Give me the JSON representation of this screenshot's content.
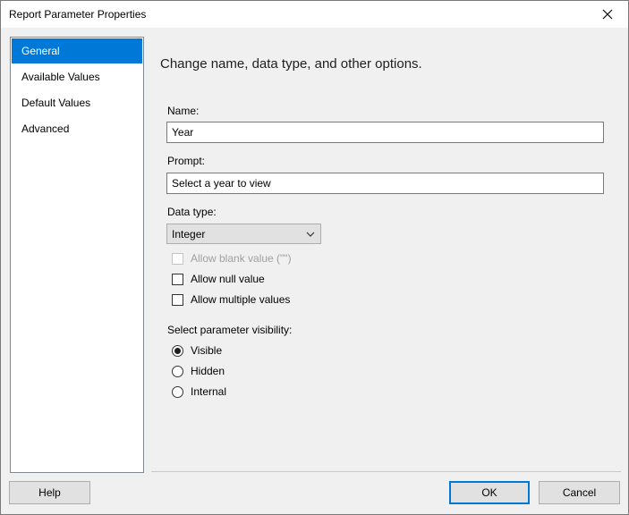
{
  "window": {
    "title": "Report Parameter Properties"
  },
  "nav": {
    "items": [
      {
        "label": "General",
        "selected": true
      },
      {
        "label": "Available Values",
        "selected": false
      },
      {
        "label": "Default Values",
        "selected": false
      },
      {
        "label": "Advanced",
        "selected": false
      }
    ]
  },
  "general": {
    "heading": "Change name, data type, and other options.",
    "name_label": "Name:",
    "name_value": "Year",
    "prompt_label": "Prompt:",
    "prompt_value": "Select a year to view",
    "datatype_label": "Data type:",
    "datatype_value": "Integer",
    "checkboxes": {
      "allow_blank": {
        "label": "Allow blank value (\"\")",
        "checked": false,
        "disabled": true
      },
      "allow_null": {
        "label": "Allow null value",
        "checked": false
      },
      "allow_multiple": {
        "label": "Allow multiple values",
        "checked": false
      }
    },
    "visibility_label": "Select parameter visibility:",
    "visibility": {
      "visible": {
        "label": "Visible",
        "checked": true
      },
      "hidden": {
        "label": "Hidden",
        "checked": false
      },
      "internal": {
        "label": "Internal",
        "checked": false
      }
    }
  },
  "footer": {
    "help": "Help",
    "ok": "OK",
    "cancel": "Cancel"
  },
  "icons": {
    "close": "close-icon",
    "chevron": "chevron-down-icon"
  },
  "colors": {
    "accent": "#0078d7"
  }
}
